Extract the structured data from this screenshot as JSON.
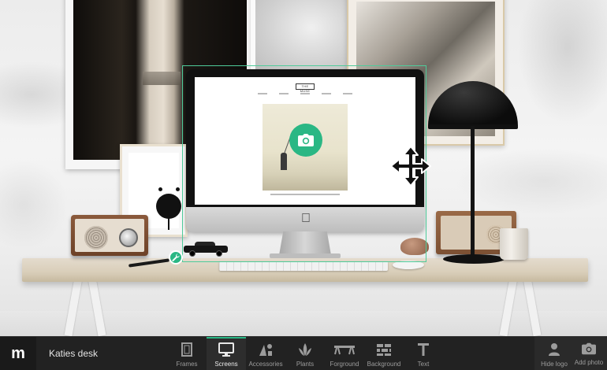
{
  "app": {
    "logo_text": "m",
    "document_title": "Katies desk"
  },
  "toolbar": {
    "categories": [
      {
        "label": "Frames",
        "icon": "frame-icon",
        "active": false
      },
      {
        "label": "Screens",
        "icon": "monitor-icon",
        "active": true
      },
      {
        "label": "Accessories",
        "icon": "shapes-icon",
        "active": false
      },
      {
        "label": "Plants",
        "icon": "leaf-icon",
        "active": false
      },
      {
        "label": "Forground",
        "icon": "sawhorse-icon",
        "active": false
      },
      {
        "label": "Background",
        "icon": "brick-icon",
        "active": false
      },
      {
        "label": "Text",
        "icon": "text-icon",
        "active": false
      }
    ],
    "right_actions": [
      {
        "label": "Hide logo",
        "icon": "person-icon"
      },
      {
        "label": "Add photo",
        "icon": "camera-icon"
      }
    ]
  },
  "canvas": {
    "selected_item": "imac-screen",
    "accent_color": "#2ab784",
    "screen_site_logo": "THE MUSE"
  }
}
